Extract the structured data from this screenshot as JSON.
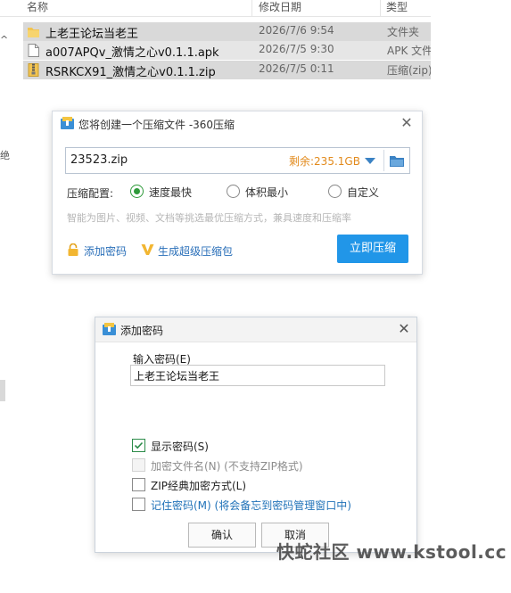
{
  "explorer": {
    "columns": {
      "name": "名称",
      "date": "修改日期",
      "type": "类型"
    },
    "left_edge": {
      "glyph_1": "^",
      "glyph_2": "绝"
    },
    "files": [
      {
        "name": "上老王论坛当老王",
        "date": "2026/7/6 9:54",
        "type": "文件夹",
        "icon": "folder-icon"
      },
      {
        "name": "a007APQv_激情之心v0.1.1.apk",
        "date": "2026/7/5 9:30",
        "type": "APK 文件",
        "icon": "file-icon"
      },
      {
        "name": "RSRKCX91_激情之心v0.1.1.zip",
        "date": "2026/7/5 0:11",
        "type": "压缩(zip)",
        "icon": "zip-icon"
      }
    ]
  },
  "compress_dialog": {
    "title": "您将创建一个压缩文件 -360压缩",
    "filename": "23523.zip",
    "free_space": "剩余:235.1GB",
    "option_label": "压缩配置:",
    "options": [
      {
        "label": "速度最快",
        "selected": true
      },
      {
        "label": "体积最小",
        "selected": false
      },
      {
        "label": "自定义",
        "selected": false
      }
    ],
    "hint": "智能为图片、视频、文档等挑选最优压缩方式，兼具速度和压缩率",
    "add_password_link": "添加密码",
    "sfx_link": "生成超级压缩包",
    "compress_button": "立即压缩",
    "accent_color": "#2196e8"
  },
  "password_dialog": {
    "title": "添加密码",
    "input_label": "输入密码(E)",
    "password_value": "上老王论坛当老王",
    "checkboxes": [
      {
        "label": "显示密码(S)",
        "checked": true,
        "disabled": false
      },
      {
        "label": "加密文件名(N) (不支持ZIP格式)",
        "checked": false,
        "disabled": true
      },
      {
        "label": "ZIP经典加密方式(L)",
        "checked": false,
        "disabled": false
      },
      {
        "label": "记住密码(M) (将会备忘到密码管理窗口中)",
        "checked": false,
        "disabled": false
      }
    ],
    "ok_button": "确认",
    "cancel_button": "取消"
  },
  "watermark": "快蛇社区 www.kstool.cc"
}
